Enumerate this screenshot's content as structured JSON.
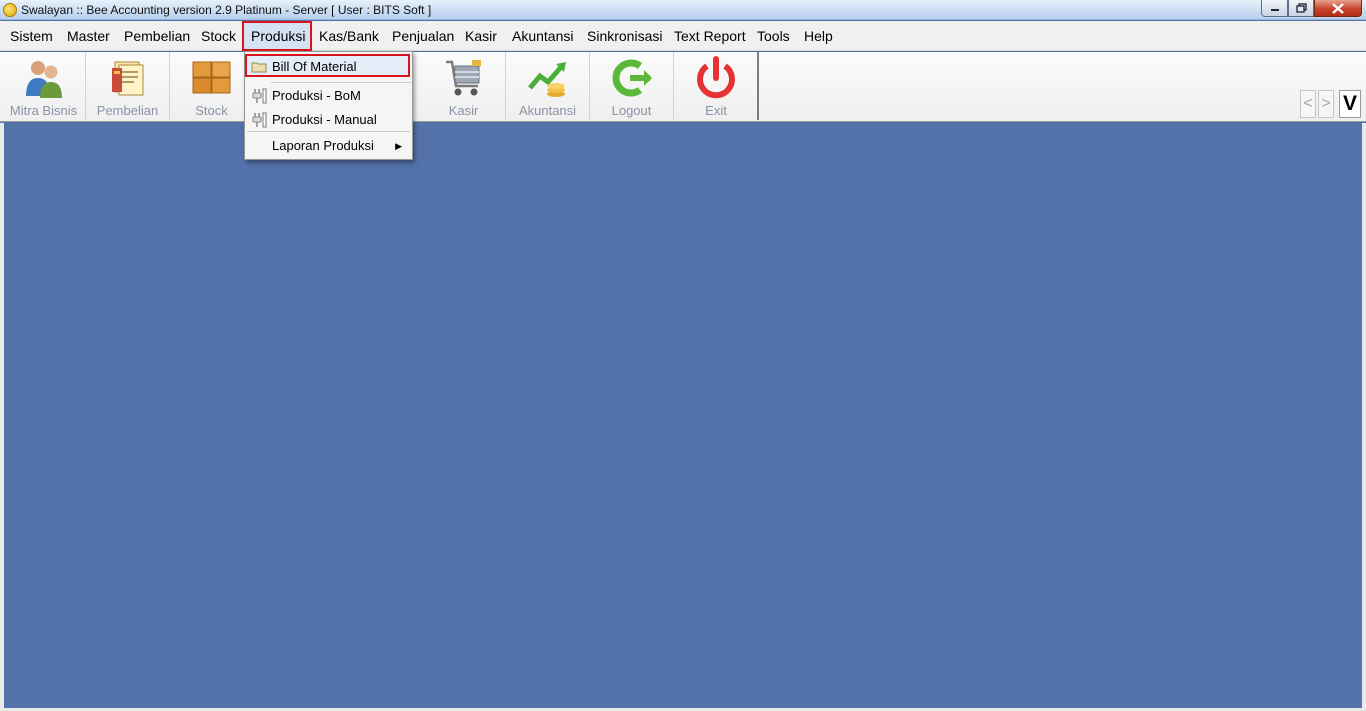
{
  "window": {
    "title": "Swalayan :: Bee Accounting version 2.9 Platinum - Server  [ User : BITS Soft ]"
  },
  "menubar": {
    "items": [
      {
        "label": "Sistem"
      },
      {
        "label": "Master"
      },
      {
        "label": "Pembelian"
      },
      {
        "label": "Stock"
      },
      {
        "label": "Produksi"
      },
      {
        "label": "Kas/Bank"
      },
      {
        "label": "Penjualan"
      },
      {
        "label": "Kasir"
      },
      {
        "label": "Akuntansi"
      },
      {
        "label": "Sinkronisasi"
      },
      {
        "label": "Text Report"
      },
      {
        "label": "Tools"
      },
      {
        "label": "Help"
      }
    ],
    "active": "Produksi"
  },
  "toolbar": {
    "buttons": [
      {
        "label": "Mitra Bisnis",
        "icon": "partners-icon"
      },
      {
        "label": "Pembelian",
        "icon": "purchase-icon"
      },
      {
        "label": "Stock",
        "icon": "boxes-icon"
      },
      {
        "label": "Kasir",
        "icon": "cart-icon"
      },
      {
        "label": "Akuntansi",
        "icon": "chart-coins-icon"
      },
      {
        "label": "Logout",
        "icon": "logout-icon"
      },
      {
        "label": "Exit",
        "icon": "power-icon"
      }
    ],
    "nav": {
      "prev": "<",
      "next": ">",
      "toggle": "V"
    }
  },
  "dropdown": {
    "items": [
      {
        "label": "Bill Of Material",
        "icon": "folder-icon",
        "highlighted": true
      },
      {
        "label": "Produksi - BoM",
        "icon": "plug-icon"
      },
      {
        "label": "Produksi - Manual",
        "icon": "plug-icon"
      },
      {
        "label": "Laporan Produksi",
        "submenu": true
      }
    ]
  },
  "colors": {
    "workspace": "#5472aa",
    "highlight_border": "#d8141e",
    "toolbar_label": "#8a93a4"
  }
}
